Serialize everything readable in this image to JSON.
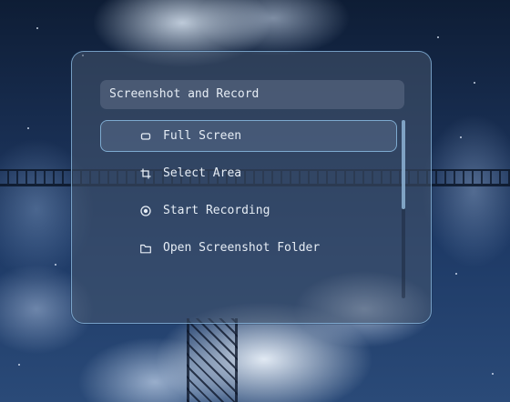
{
  "launcher": {
    "prompt": "Screenshot and Record",
    "items": [
      {
        "label": "Full Screen",
        "icon": "screen-rectangle-icon",
        "selected": true
      },
      {
        "label": "Select Area",
        "icon": "crop-icon",
        "selected": false
      },
      {
        "label": "Start Recording",
        "icon": "record-icon",
        "selected": false
      },
      {
        "label": "Open Screenshot Folder",
        "icon": "folder-icon",
        "selected": false
      }
    ],
    "scroll_fraction_visible": 0.5
  },
  "colors": {
    "accent": "#8cbee6",
    "text": "#e6edf5"
  }
}
